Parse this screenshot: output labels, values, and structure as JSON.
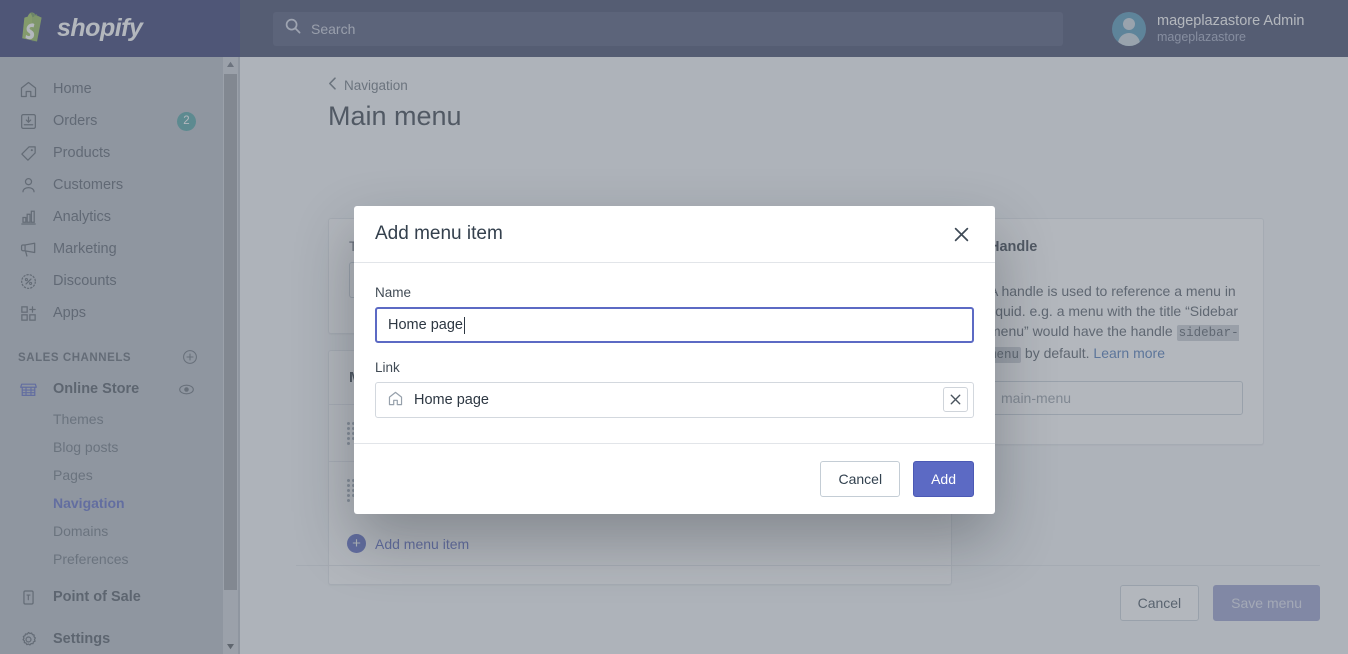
{
  "topbar": {
    "brand_name": "shopify",
    "brand_logo_icon": "shopify-bag-icon",
    "search": {
      "icon": "search-icon",
      "placeholder": "Search",
      "value": ""
    },
    "user": {
      "name": "mageplazastore Admin",
      "store": "mageplazastore",
      "avatar_icon": "user-avatar-icon"
    }
  },
  "sidebar": {
    "items": [
      {
        "label": "Home",
        "icon": "home-icon",
        "badge": ""
      },
      {
        "label": "Orders",
        "icon": "orders-icon",
        "badge": "2"
      },
      {
        "label": "Products",
        "icon": "products-tag-icon",
        "badge": ""
      },
      {
        "label": "Customers",
        "icon": "customers-icon",
        "badge": ""
      },
      {
        "label": "Analytics",
        "icon": "analytics-bar-icon",
        "badge": ""
      },
      {
        "label": "Marketing",
        "icon": "marketing-megaphone-icon",
        "badge": ""
      },
      {
        "label": "Discounts",
        "icon": "discounts-icon",
        "badge": ""
      },
      {
        "label": "Apps",
        "icon": "apps-icon",
        "badge": ""
      }
    ],
    "section_title": "SALES CHANNELS",
    "section_add_icon": "plus-circle-icon",
    "online_store": {
      "label": "Online Store",
      "icon": "store-icon",
      "view_icon": "eye-icon"
    },
    "sub_items": [
      {
        "label": "Themes",
        "active": false
      },
      {
        "label": "Blog posts",
        "active": false
      },
      {
        "label": "Pages",
        "active": false
      },
      {
        "label": "Navigation",
        "active": true
      },
      {
        "label": "Domains",
        "active": false
      },
      {
        "label": "Preferences",
        "active": false
      }
    ],
    "point_of_sale": {
      "label": "Point of Sale",
      "icon": "pos-icon"
    },
    "settings": {
      "label": "Settings",
      "icon": "gear-icon"
    },
    "scrollbar": {
      "up_icon": "scroll-up-arrow-icon",
      "down_icon": "scroll-down-arrow-icon"
    }
  },
  "main": {
    "breadcrumb": {
      "icon": "chevron-left-icon",
      "label": "Navigation"
    },
    "page_title": "Main menu",
    "title_card": {
      "label": "Title",
      "value": ""
    },
    "menu_card": {
      "heading": "Menu items",
      "rows": [
        {
          "grip_icon": "drag-grip-icon"
        },
        {
          "grip_icon": "drag-grip-icon"
        }
      ],
      "add_label": "Add menu item",
      "add_icon": "plus-circle-icon"
    },
    "handle_card": {
      "heading": "Handle",
      "text_part1": "A handle is used to reference a menu in liquid. e.g. a menu with the title “Sidebar menu” would have the handle ",
      "code": "sidebar-menu",
      "text_part2": " by default. ",
      "learn_more": "Learn more",
      "input_value": "main-menu"
    },
    "footer": {
      "cancel_label": "Cancel",
      "save_label": "Save menu",
      "save_disabled": true
    }
  },
  "modal": {
    "title": "Add menu item",
    "close_icon": "close-x-icon",
    "name_label": "Name",
    "name_value": "Home page",
    "link_label": "Link",
    "link_icon": "home-icon",
    "link_value": "Home page",
    "link_clear_icon": "clear-x-icon",
    "cancel_label": "Cancel",
    "add_label": "Add"
  },
  "colors": {
    "topbar_bg": "#2b3357",
    "brand_bg": "#1c2260",
    "sidebar_bg": "#aeb4be",
    "accent_indigo": "#5c6ac4",
    "active_link": "#4959bd",
    "badge_teal": "#3c9a9a",
    "link_blue": "#3a69b0",
    "page_bg": "#f4f6f8"
  }
}
